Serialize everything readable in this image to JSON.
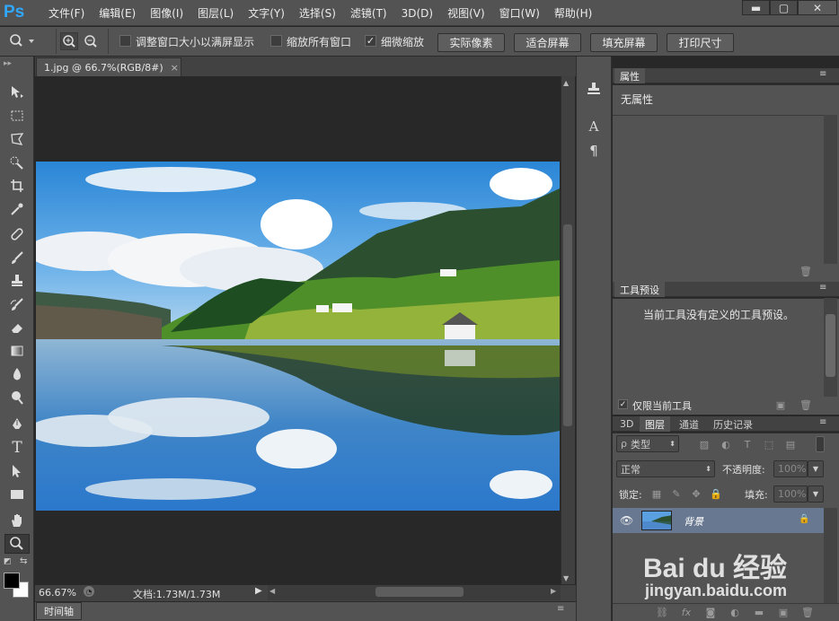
{
  "app": {
    "logo": "Ps"
  },
  "menu": [
    "文件(F)",
    "编辑(E)",
    "图像(I)",
    "图层(L)",
    "文字(Y)",
    "选择(S)",
    "滤镜(T)",
    "3D(D)",
    "视图(V)",
    "窗口(W)",
    "帮助(H)"
  ],
  "window_controls": {
    "minimize": "▬",
    "maximize": "▢",
    "close": "✕"
  },
  "options": {
    "resize_windows": {
      "label": "调整窗口大小以满屏显示",
      "checked": false
    },
    "zoom_all": {
      "label": "缩放所有窗口",
      "checked": false
    },
    "scrubby_zoom": {
      "label": "细微缩放",
      "checked": true
    },
    "buttons": [
      "实际像素",
      "适合屏幕",
      "填充屏幕",
      "打印尺寸"
    ]
  },
  "document": {
    "tab_title": "1.jpg @ 66.7%(RGB/8#)",
    "tab_close": "×"
  },
  "status": {
    "zoom": "66.67%",
    "doc_info": "文档:1.73M/1.73M"
  },
  "timeline_label": "时间轴",
  "properties": {
    "title": "属性",
    "value": "无属性"
  },
  "tool_presets": {
    "title": "工具预设",
    "message": "当前工具没有定义的工具预设。",
    "current_only": "仅限当前工具"
  },
  "layers": {
    "tabs": [
      "3D",
      "图层",
      "通道",
      "历史记录"
    ],
    "active_tab": "图层",
    "filter_kind": "类型",
    "blend_mode": "正常",
    "opacity_label": "不透明度:",
    "opacity": "100%",
    "lock_label": "锁定:",
    "fill_label": "填充:",
    "fill": "100%",
    "layer_name": "背景"
  },
  "watermark": {
    "brand": "Bai du 经验",
    "url": "jingyan.baidu.com"
  },
  "colors": {
    "ps_blue": "#31a8ff",
    "panel_bg": "#535353",
    "dark_bg": "#282828"
  }
}
